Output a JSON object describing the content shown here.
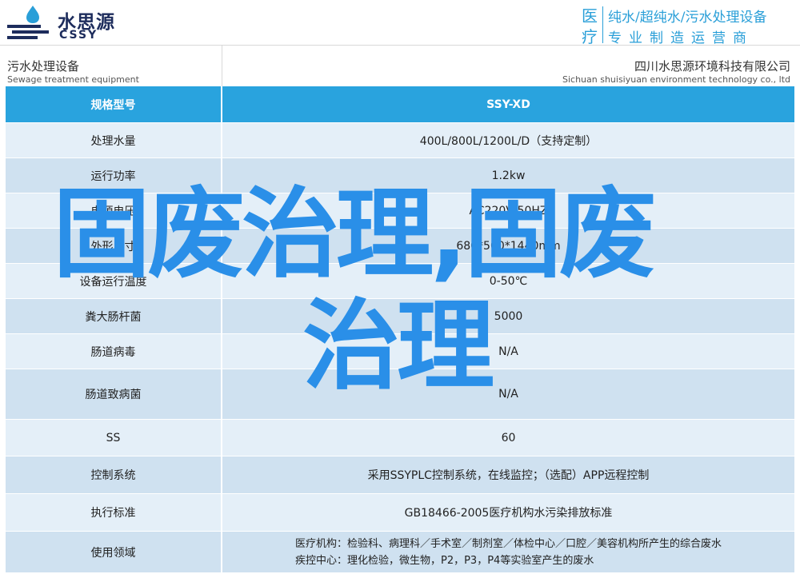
{
  "brand": {
    "name_cn": "水思源",
    "name_en": "CSSY",
    "colors": {
      "navy": "#1d2c5c",
      "sky": "#2a9fd8",
      "header_blue": "#29a3de",
      "watermark": "#2a8fe8"
    }
  },
  "category": {
    "char_top": "医",
    "char_bottom": "疗",
    "line1": "纯水/超纯水/污水处理设备",
    "line2": "专业制造运营商"
  },
  "subheader": {
    "left_cn": "污水处理设备",
    "left_en": "Sewage treatment equipment",
    "right_cn": "四川水思源环境科技有限公司",
    "right_en": "Sichuan shuisiyuan environment technology co., ltd"
  },
  "table": {
    "header": {
      "key": "规格型号",
      "value": "SSY-XD"
    },
    "rows": [
      {
        "key": "处理水量",
        "value": "400L/800L/1200L/D（支持定制）"
      },
      {
        "key": "运行功率",
        "value": "1.2kw"
      },
      {
        "key": "电源电压",
        "value": "AC220V/50HZ"
      },
      {
        "key": "外形尺寸",
        "value": "680*500*1440mm"
      },
      {
        "key": "设备运行温度",
        "value": "0-50℃"
      },
      {
        "key": "粪大肠杆菌",
        "value": "5000"
      },
      {
        "key": "肠道病毒",
        "value": "N/A"
      },
      {
        "key": "肠道致病菌",
        "value": "N/A"
      },
      {
        "key": "SS",
        "value": "60"
      },
      {
        "key": "控制系统",
        "value": "采用SSYPLC控制系统，在线监控；（选配）APP远程控制"
      },
      {
        "key": "执行标准",
        "value": "GB18466-2005医疗机构水污染排放标准"
      },
      {
        "key": "使用领域",
        "value_line1": "医疗机构：检验科、病理科／手术室／制剂室／体检中心／口腔／美容机构所产生的综合废水",
        "value_line2": "疾控中心：理化检验，微生物，P2，P3，P4等实验室产生的废水"
      }
    ]
  },
  "watermark": {
    "line1": "固废治理,固废",
    "line2": "治理"
  }
}
